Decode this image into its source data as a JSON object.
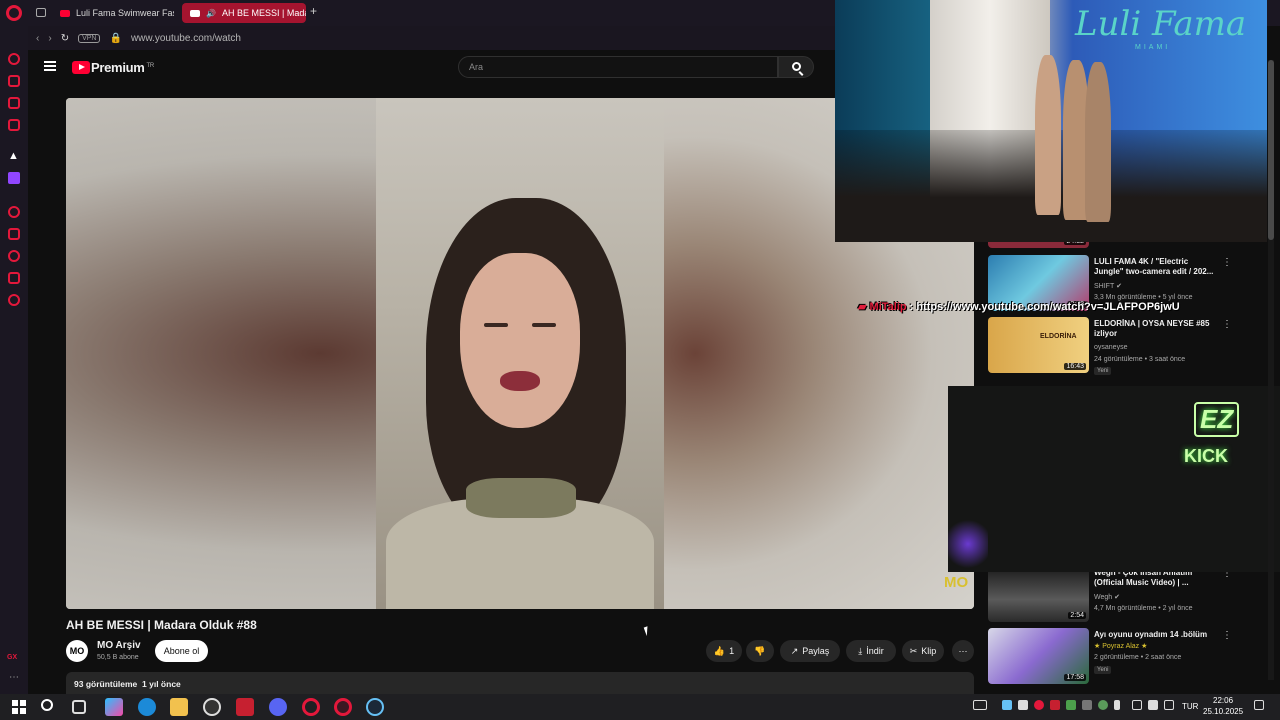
{
  "browser": {
    "tabs": [
      {
        "label": "Luli Fama Swimwear Fash"
      },
      {
        "label": "AH BE MESSI | Madar"
      }
    ],
    "new_tab": "+",
    "vpn_label": "VPN",
    "url": "www.youtube.com/watch"
  },
  "youtube": {
    "logo_text": "Premium",
    "region": "TR",
    "search_placeholder": "Ara"
  },
  "video": {
    "watermark": "MO",
    "title": "AH BE MESSI | Madara Olduk #88",
    "channel": {
      "avatar_text": "MO",
      "name": "MO Arşiv",
      "subscribers": "50,5 B abone"
    },
    "subscribe_label": "Abone ol",
    "likes": "1",
    "share_label": "Paylaş",
    "download_label": "İndir",
    "clip_label": "Klip",
    "more_label": "⋯",
    "views": "93 görüntüleme",
    "age": "1 yıl önce"
  },
  "recommendations": [
    {
      "duration": "24:32"
    },
    {
      "title": "LULI FAMA 4K / \"Electric Jungle\" two-camera edit / 202...",
      "channel": "SHIFT",
      "verified": true,
      "meta": "3,3 Mn görüntüleme • 5 yıl önce",
      "duration": "2:38"
    },
    {
      "title": "ELDORİNA | OYSA NEYSE #85 izliyor",
      "channel": "oysaneyse",
      "meta": "24 görüntüleme • 3 saat önce",
      "badge": "Yeni",
      "duration": "16:43",
      "thumb_text": "ELDORİNA"
    },
    {
      "title": "Wegh - Çok İnsan Anlatım (Official Music Video) | ...",
      "channel": "Wegh",
      "verified": true,
      "meta": "4,7 Mn görüntüleme • 2 yıl önce",
      "duration": "2:54"
    },
    {
      "title": "Ayı oyunu oynadım 14 .bölüm",
      "channel": "★ Poyraz Alaz ★",
      "meta": "2 görüntüleme • 2 saat önce",
      "badge": "Yeni",
      "duration": "17:58"
    }
  ],
  "overlays": {
    "runway_brand": "Luli Fama",
    "runway_sub": "MIAMI",
    "chat_user": "MiTalip",
    "chat_sep": " : ",
    "chat_message": "https://www.youtube.com/watch?v=JLAFPOP6jwU",
    "neon_logo": "EZ",
    "neon_kick": "KICK"
  },
  "taskbar": {
    "language": "TUR",
    "time": "22:06",
    "date": "25.10.2025"
  },
  "colors": {
    "opera_red": "#e3183b",
    "yt_red": "#ff0033",
    "dark_bg": "#0f0f0f"
  }
}
